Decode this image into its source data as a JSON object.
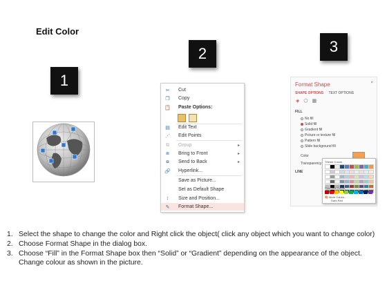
{
  "title": "Edit Color",
  "badges": [
    "1",
    "2",
    "3"
  ],
  "context_menu": {
    "items": [
      {
        "label": "Cut",
        "icon": "scissors-icon",
        "disabled": false,
        "submenu": false
      },
      {
        "label": "Copy",
        "icon": "copy-icon",
        "disabled": false,
        "submenu": false
      },
      {
        "label": "Paste Options:",
        "icon": "paste-icon",
        "disabled": false,
        "submenu": false,
        "bold": true
      },
      {
        "label": "Edit Text",
        "icon": "edit-text-icon",
        "disabled": false,
        "submenu": false
      },
      {
        "label": "Edit Points",
        "icon": "edit-points-icon",
        "disabled": false,
        "submenu": false
      },
      {
        "label": "Group",
        "icon": "group-icon",
        "disabled": true,
        "submenu": true
      },
      {
        "label": "Bring to Front",
        "icon": "bring-front-icon",
        "disabled": false,
        "submenu": true
      },
      {
        "label": "Send to Back",
        "icon": "send-back-icon",
        "disabled": false,
        "submenu": true
      },
      {
        "label": "Hyperlink...",
        "icon": "hyperlink-icon",
        "disabled": false,
        "submenu": false
      },
      {
        "label": "Save as Picture...",
        "icon": "",
        "disabled": false,
        "submenu": false
      },
      {
        "label": "Set as Default Shape",
        "icon": "",
        "disabled": false,
        "submenu": false
      },
      {
        "label": "Size and Position...",
        "icon": "size-position-icon",
        "disabled": false,
        "submenu": false
      },
      {
        "label": "Format Shape...",
        "icon": "format-shape-icon",
        "disabled": false,
        "submenu": false,
        "highlight": true
      }
    ]
  },
  "format_panel": {
    "title": "Format Shape",
    "close": "×",
    "tab_active": "SHAPE OPTIONS",
    "tab_other": "TEXT OPTIONS",
    "fill_header": "FILL",
    "fill_options": [
      {
        "label": "No fill",
        "selected": false
      },
      {
        "label": "Solid fill",
        "selected": true
      },
      {
        "label": "Gradient fill",
        "selected": false
      },
      {
        "label": "Picture or texture fill",
        "selected": false
      },
      {
        "label": "Pattern fill",
        "selected": false
      },
      {
        "label": "Slide background fill",
        "selected": false
      }
    ],
    "color_label": "Color",
    "transparency_label": "Transparency",
    "line_header": "LINE",
    "palette": {
      "theme_label": "Theme Colors",
      "standard_label": "Standard Colors",
      "more_label": "More Colors...",
      "dark_label": "Dark Red",
      "theme_top": [
        "#ffffff",
        "#000000",
        "#eeece1",
        "#1f497d",
        "#4f81bd",
        "#c0504d",
        "#9bbb59",
        "#8064a2",
        "#4bacc6",
        "#f79646"
      ],
      "standard": [
        "#c00000",
        "#ff0000",
        "#ffc000",
        "#ffff00",
        "#92d050",
        "#00b050",
        "#00b0f0",
        "#0070c0",
        "#002060",
        "#7030a0"
      ]
    }
  },
  "steps": [
    {
      "num": "1.",
      "text": "Select the shape to change the color and Right click the object( click any object which you want to change color)"
    },
    {
      "num": "2.",
      "text": "Choose Format Shape in the dialog box."
    },
    {
      "num": "3.",
      "text": "Choose “Fill” in the Format Shape box then “Solid” or “Gradient” depending on the appearance of the object. Change colour as shown in the picture."
    }
  ]
}
